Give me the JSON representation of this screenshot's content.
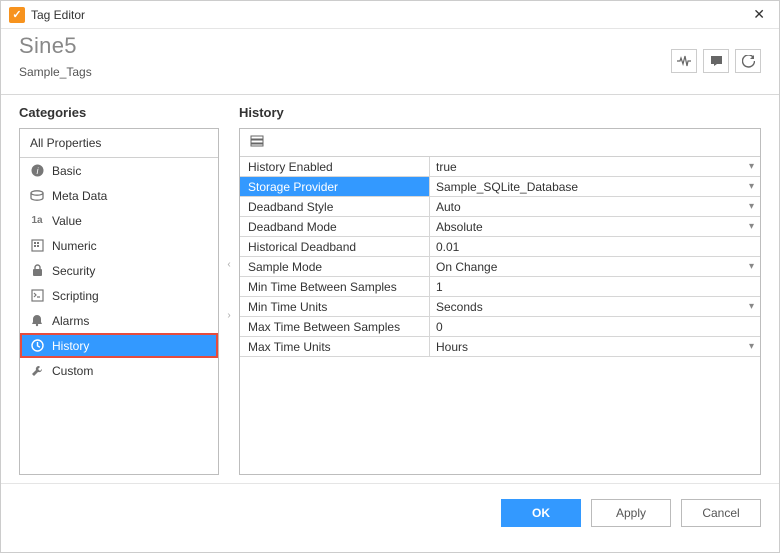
{
  "window": {
    "title": "Tag Editor"
  },
  "header": {
    "title": "Sine5",
    "subtitle": "Sample_Tags"
  },
  "categories": {
    "section_title": "Categories",
    "header": "All Properties",
    "items": [
      {
        "label": "Basic",
        "icon": "info-icon"
      },
      {
        "label": "Meta Data",
        "icon": "metadata-icon"
      },
      {
        "label": "Value",
        "icon": "value-icon"
      },
      {
        "label": "Numeric",
        "icon": "numeric-icon"
      },
      {
        "label": "Security",
        "icon": "lock-icon"
      },
      {
        "label": "Scripting",
        "icon": "script-icon"
      },
      {
        "label": "Alarms",
        "icon": "bell-icon"
      },
      {
        "label": "History",
        "icon": "clock-icon",
        "selected": true,
        "highlight": true
      },
      {
        "label": "Custom",
        "icon": "wrench-icon"
      }
    ]
  },
  "properties": {
    "section_title": "History",
    "rows": [
      {
        "label": "History Enabled",
        "value": "true",
        "dropdown": true
      },
      {
        "label": "Storage Provider",
        "value": "Sample_SQLite_Database",
        "dropdown": true,
        "selected": true
      },
      {
        "label": "Deadband Style",
        "value": "Auto",
        "dropdown": true
      },
      {
        "label": "Deadband Mode",
        "value": "Absolute",
        "dropdown": true
      },
      {
        "label": "Historical Deadband",
        "value": "0.01",
        "dropdown": false
      },
      {
        "label": "Sample Mode",
        "value": "On Change",
        "dropdown": true
      },
      {
        "label": "Min Time Between Samples",
        "value": "1",
        "dropdown": false
      },
      {
        "label": "Min Time Units",
        "value": "Seconds",
        "dropdown": true
      },
      {
        "label": "Max Time Between Samples",
        "value": "0",
        "dropdown": false
      },
      {
        "label": "Max Time Units",
        "value": "Hours",
        "dropdown": true
      }
    ]
  },
  "footer": {
    "ok": "OK",
    "apply": "Apply",
    "cancel": "Cancel"
  }
}
